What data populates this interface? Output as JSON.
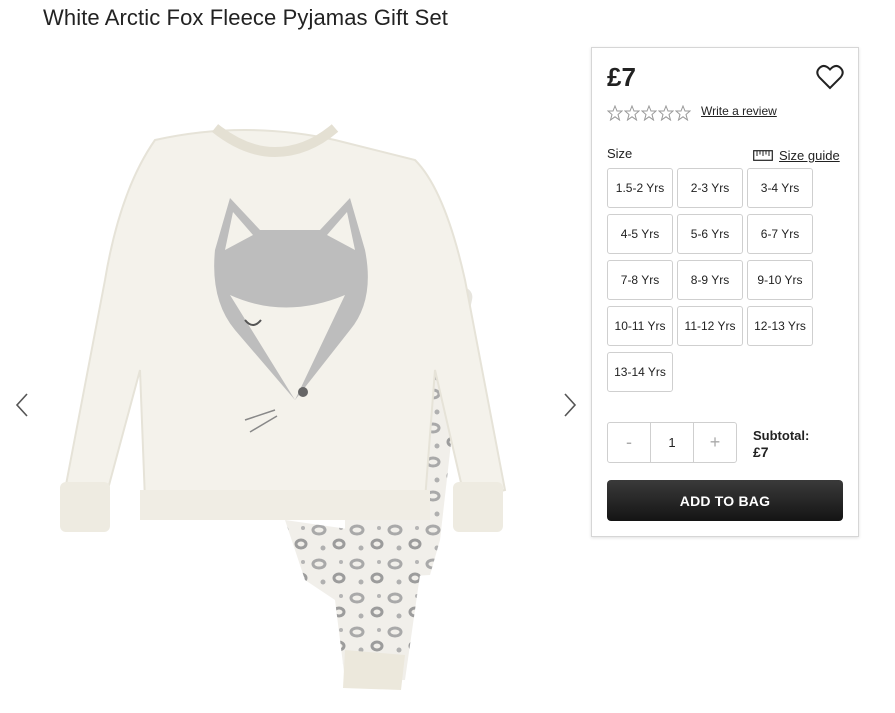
{
  "product": {
    "title": "White Arctic Fox Fleece Pyjamas Gift Set",
    "price": "£7",
    "rating_stars": 0,
    "review_link": "Write a review"
  },
  "gallery": {
    "prev_icon": "chevron-left-icon",
    "next_icon": "chevron-right-icon",
    "image_subject": "white fleece pyjama set with grey fox face appliqué top and snow leopard print bottoms"
  },
  "size": {
    "label": "Size",
    "guide_label": "Size guide",
    "options": [
      "1.5-2 Yrs",
      "2-3 Yrs",
      "3-4 Yrs",
      "4-5 Yrs",
      "5-6 Yrs",
      "6-7 Yrs",
      "7-8 Yrs",
      "8-9 Yrs",
      "9-10 Yrs",
      "10-11 Yrs",
      "11-12 Yrs",
      "12-13 Yrs",
      "13-14 Yrs"
    ]
  },
  "quantity": {
    "minus": "-",
    "value": "1",
    "plus": "+"
  },
  "subtotal": {
    "label": "Subtotal:",
    "amount": "£7"
  },
  "actions": {
    "add_to_bag": "ADD TO BAG"
  },
  "colors": {
    "button_dark": "#1e1e1e",
    "border": "#cfcfcf",
    "text": "#222222"
  }
}
